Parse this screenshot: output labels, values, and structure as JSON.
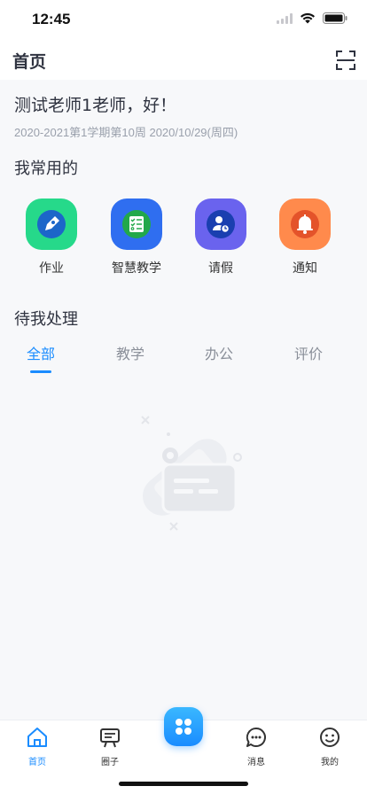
{
  "status_bar": {
    "time": "12:45"
  },
  "nav": {
    "title": "首页"
  },
  "greeting": "测试老师1老师，好！",
  "term_info": "2020-2021第1学期第10周 2020/10/29(周四)",
  "frequent": {
    "title": "我常用的",
    "items": [
      {
        "label": "作业",
        "icon": "pen-icon",
        "color": "#26d98a"
      },
      {
        "label": "智慧教学",
        "icon": "checklist-icon",
        "color": "#2f6ef0"
      },
      {
        "label": "请假",
        "icon": "user-clock-icon",
        "color": "#6a63ee"
      },
      {
        "label": "通知",
        "icon": "bell-icon",
        "color": "#ff8a4c"
      }
    ]
  },
  "pending": {
    "title": "待我处理",
    "tabs": [
      "全部",
      "教学",
      "办公",
      "评价"
    ],
    "active_tab": 0
  },
  "tabbar": {
    "items": [
      {
        "label": "首页",
        "icon": "home-icon",
        "active": true
      },
      {
        "label": "圈子",
        "icon": "board-icon",
        "active": false
      },
      {
        "label": "消息",
        "icon": "chat-icon",
        "active": false
      },
      {
        "label": "我的",
        "icon": "smile-icon",
        "active": false
      }
    ],
    "center_icon": "apps-icon"
  },
  "colors": {
    "accent": "#1a8cff",
    "text": "#2f3340",
    "muted": "#9aa0ac"
  }
}
